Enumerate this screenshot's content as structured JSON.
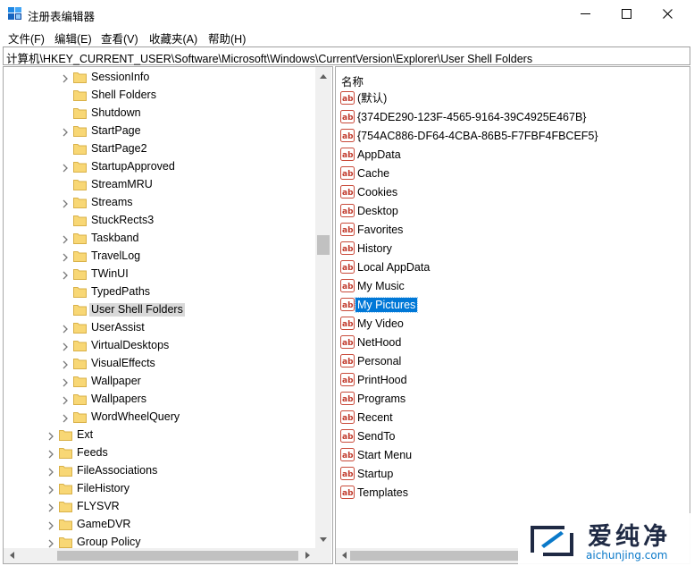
{
  "window": {
    "title": "注册表编辑器",
    "icon": "registry-editor-icon"
  },
  "menu": [
    "文件(F)",
    "编辑(E)",
    "查看(V)",
    "收藏夹(A)",
    "帮助(H)"
  ],
  "address": "计算机\\HKEY_CURRENT_USER\\Software\\Microsoft\\Windows\\CurrentVersion\\Explorer\\User Shell Folders",
  "tree": {
    "children": [
      {
        "label": "SessionInfo",
        "expandable": true
      },
      {
        "label": "Shell Folders",
        "expandable": false
      },
      {
        "label": "Shutdown",
        "expandable": false
      },
      {
        "label": "StartPage",
        "expandable": true
      },
      {
        "label": "StartPage2",
        "expandable": false
      },
      {
        "label": "StartupApproved",
        "expandable": true
      },
      {
        "label": "StreamMRU",
        "expandable": false
      },
      {
        "label": "Streams",
        "expandable": true
      },
      {
        "label": "StuckRects3",
        "expandable": false
      },
      {
        "label": "Taskband",
        "expandable": true
      },
      {
        "label": "TravelLog",
        "expandable": true
      },
      {
        "label": "TWinUI",
        "expandable": true
      },
      {
        "label": "TypedPaths",
        "expandable": false
      },
      {
        "label": "User Shell Folders",
        "expandable": false,
        "selected": true
      },
      {
        "label": "UserAssist",
        "expandable": true
      },
      {
        "label": "VirtualDesktops",
        "expandable": true
      },
      {
        "label": "VisualEffects",
        "expandable": true
      },
      {
        "label": "Wallpaper",
        "expandable": true
      },
      {
        "label": "Wallpapers",
        "expandable": true
      },
      {
        "label": "WordWheelQuery",
        "expandable": true
      }
    ],
    "siblings": [
      {
        "label": "Ext",
        "expandable": true
      },
      {
        "label": "Feeds",
        "expandable": true
      },
      {
        "label": "FileAssociations",
        "expandable": true
      },
      {
        "label": "FileHistory",
        "expandable": true
      },
      {
        "label": "FLYSVR",
        "expandable": true
      },
      {
        "label": "GameDVR",
        "expandable": true
      },
      {
        "label": "Group Policy",
        "expandable": true
      }
    ]
  },
  "values": {
    "column_name": "名称",
    "items": [
      "(默认)",
      "{374DE290-123F-4565-9164-39C4925E467B}",
      "{754AC886-DF64-4CBA-86B5-F7FBF4FBCEF5}",
      "AppData",
      "Cache",
      "Cookies",
      "Desktop",
      "Favorites",
      "History",
      "Local AppData",
      "My Music",
      "My Pictures",
      "My Video",
      "NetHood",
      "Personal",
      "PrintHood",
      "Programs",
      "Recent",
      "SendTo",
      "Start Menu",
      "Startup",
      "Templates"
    ],
    "selected": "My Pictures"
  },
  "watermark": {
    "text": "爱纯净",
    "url": "aichunjing.com"
  },
  "colors": {
    "selection": "#0078d7",
    "folder": "#f8d775",
    "ab_icon": "#c0392b"
  }
}
